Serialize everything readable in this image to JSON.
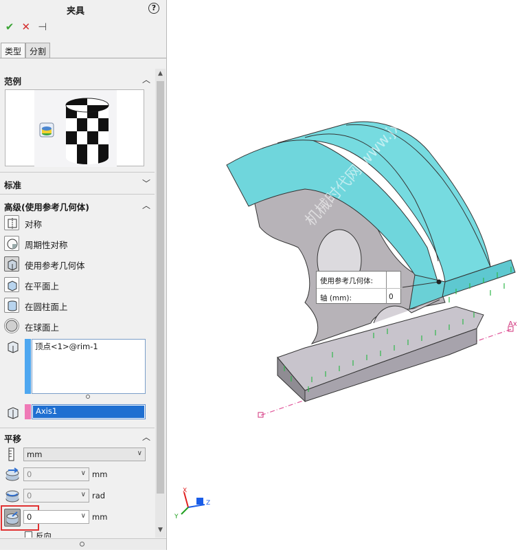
{
  "panel": {
    "title": "夹具",
    "help": "?",
    "actions": [
      {
        "name": "ok",
        "glyph": "✔",
        "color": "#3aa435"
      },
      {
        "name": "cancel",
        "glyph": "✕",
        "color": "#d42d2d"
      },
      {
        "name": "pin",
        "glyph": "⊣",
        "color": "#555555"
      }
    ],
    "tabs": [
      {
        "label": "类型",
        "active": true
      },
      {
        "label": "分割",
        "active": false
      }
    ],
    "groups": {
      "example": {
        "title": "范例"
      },
      "standard": {
        "title": "标准"
      },
      "advanced": {
        "title": "高级(使用参考几何体)",
        "options": [
          {
            "label": "对称",
            "icon": "symmetry-icon",
            "selected": false
          },
          {
            "label": "周期性对称",
            "icon": "circular-symmetry-icon",
            "selected": false
          },
          {
            "label": "使用参考几何体",
            "icon": "reference-geometry-icon",
            "selected": true
          },
          {
            "label": "在平面上",
            "icon": "on-flat-face-icon",
            "selected": false
          },
          {
            "label": "在圆柱面上",
            "icon": "on-cylindrical-face-icon",
            "selected": false
          },
          {
            "label": "在球面上",
            "icon": "on-spherical-face-icon",
            "selected": false
          }
        ],
        "faces_list": [
          "顶点<1>@rim-1"
        ],
        "reference_list": [
          "Axis1"
        ]
      },
      "translation": {
        "title": "平移",
        "unit_select": "mm",
        "rows": [
          {
            "value": "0",
            "unit": "mm",
            "enabled": false
          },
          {
            "value": "0",
            "unit": "rad",
            "enabled": false
          },
          {
            "value": "0",
            "unit": "mm",
            "enabled": true,
            "highlighted": true
          }
        ],
        "reverse_label": "反向"
      }
    }
  },
  "viewport": {
    "callout": {
      "row1_label": "使用参考几何体:",
      "row2_label": "轴 (mm):",
      "row2_value": "0"
    },
    "axis_label": "Ax",
    "watermark": "机械时代网 www.jxage.com",
    "triad": {
      "x": "X",
      "y": "Y",
      "z": "Z"
    }
  },
  "colors": {
    "highlight_red": "#e03030",
    "teal_face": "#6fd6dc",
    "grey_face": "#b7b3b8",
    "fixture_green": "#2fb84a",
    "axis_pink": "#e0559a",
    "selection_blue": "#1f6fd1"
  }
}
